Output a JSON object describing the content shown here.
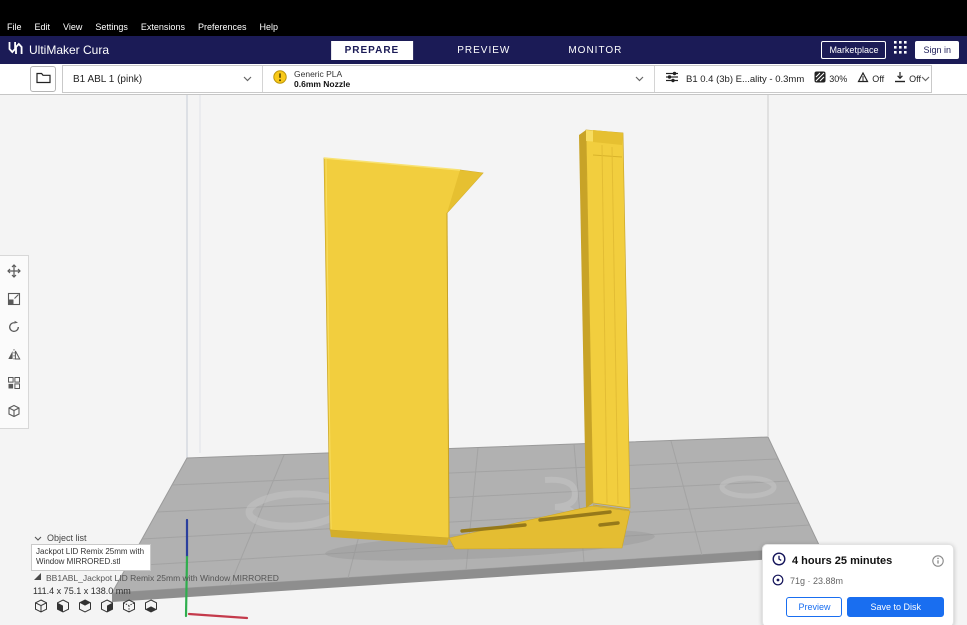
{
  "menubar": {
    "items": [
      "File",
      "Edit",
      "View",
      "Settings",
      "Extensions",
      "Preferences",
      "Help"
    ]
  },
  "header": {
    "app_title": "UltiMaker Cura",
    "stages": [
      {
        "label": "PREPARE",
        "active": true
      },
      {
        "label": "PREVIEW",
        "active": false
      },
      {
        "label": "MONITOR",
        "active": false
      }
    ],
    "marketplace_label": "Marketplace",
    "sign_in_label": "Sign in"
  },
  "config_bar": {
    "printer": {
      "name": "B1 ABL 1 (pink)"
    },
    "material": {
      "name": "Generic PLA",
      "nozzle": "0.6mm Nozzle"
    },
    "print_settings": {
      "profile": "B1 0.4 (3b) E...ality - 0.3mm",
      "infill": "30%",
      "support": "Off",
      "adhesion": "Off"
    }
  },
  "object_list": {
    "title": "Object list",
    "tooltip_line1": "Jackpot LID Remix 25mm with",
    "tooltip_line2": "Window MIRRORED.stl",
    "selected_item": "BB1ABL_Jackpot LID Remix 25mm with Window MIRRORED",
    "dimensions": "111.4 x 75.1 x 138.0 mm"
  },
  "action_panel": {
    "time": "4 hours 25 minutes",
    "material_usage": "71g · 23.88m",
    "preview_label": "Preview",
    "save_label": "Save to Disk"
  },
  "icons": {
    "header": [
      "ultimaker-logo",
      "grid-menu"
    ],
    "config": [
      "folder",
      "warning",
      "print-settings-sliders",
      "infill",
      "support",
      "adhesion"
    ],
    "toolbar": [
      "move",
      "scale",
      "rotate",
      "mirror",
      "per-model-settings",
      "support-blocker"
    ],
    "view_presets": [
      "view-3d",
      "view-front",
      "view-top",
      "view-left",
      "view-right",
      "view-bottom"
    ],
    "action_panel": [
      "clock",
      "info",
      "material-spool"
    ]
  },
  "colors": {
    "accent_blue": "#196ef0",
    "header_navy": "#1b1b56",
    "model_yellow": "#f2ce3e",
    "warning_yellow": "#f9c918"
  }
}
